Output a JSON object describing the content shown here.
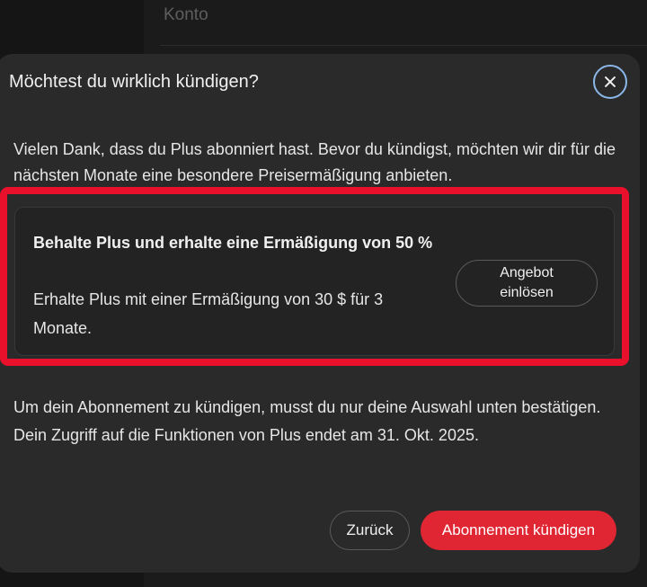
{
  "background": {
    "section_title": "Konto"
  },
  "dialog": {
    "title": "Möchtest du wirklich kündigen?",
    "close_icon": "close-icon",
    "intro": "Vielen Dank, dass du Plus abonniert hast. Bevor du kündigst, möchten wir dir für die nächsten Monate eine besondere Preisermäßigung anbieten.",
    "offer": {
      "title": "Behalte Plus und erhalte eine Ermäßigung von 50 %",
      "description": "Erhalte Plus mit einer Ermäßigung von 30 $ für 3 Monate.",
      "button_label": "Angebot einlösen"
    },
    "cancel_info": "Um dein Abonnement zu kündigen, musst du nur deine Auswahl unten bestätigen. Dein Zugriff auf die Funktionen von Plus endet am 31. Okt. 2025.",
    "back_label": "Zurück",
    "cancel_label": "Abonnement kündigen"
  },
  "colors": {
    "highlight": "#e8102a",
    "cancel_button": "#e02633",
    "close_ring": "#8ab6e8",
    "dialog_bg": "#2a2a2a"
  }
}
